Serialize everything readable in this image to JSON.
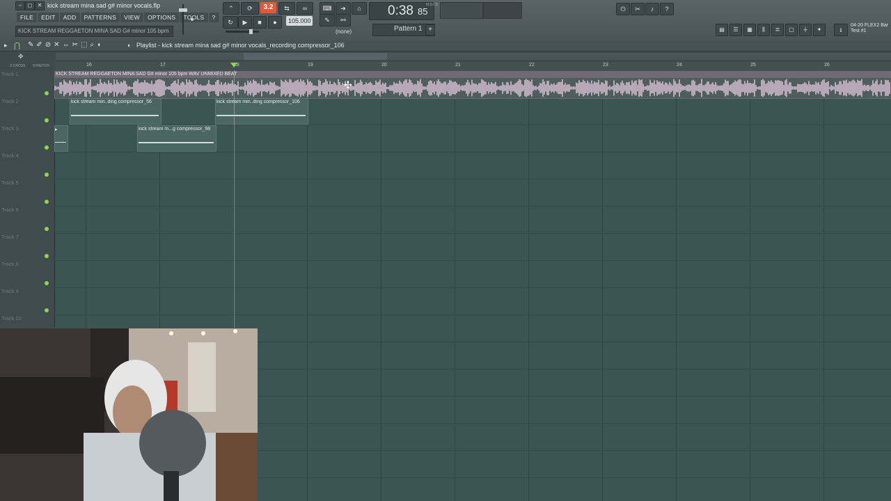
{
  "window": {
    "title": "kick stream mina sad g# minor vocals.flp",
    "menu": [
      "FILE",
      "EDIT",
      "ADD",
      "PATTERNS",
      "VIEW",
      "OPTIONS",
      "TOOLS",
      "?"
    ],
    "hint": "KICK STREAM REGGAETON MINA SAD G# minor 105 bpm"
  },
  "transport": {
    "rec_indicator": "3.2",
    "tempo": "105.000",
    "time_main": "0:38",
    "time_frac": "85",
    "time_unit": "M:S:CS",
    "pattern": "Pattern 1",
    "none": "(none)"
  },
  "right_panel": {
    "line1": "04-20 FLEX2 Bar",
    "line2": "Test #1"
  },
  "playlist": {
    "title": "Playlist - kick stream mina sad g# minor vocals_recording compressor_106",
    "bars": [
      "16",
      "17",
      "18",
      "19",
      "20",
      "21",
      "22",
      "23",
      "24",
      "25",
      "26"
    ],
    "tracks": [
      "Track 1",
      "Track 2",
      "Track 3",
      "Track 4",
      "Track 5",
      "Track 6",
      "Track 7",
      "Track 8",
      "Track 9",
      "Track 10"
    ],
    "header_labels": [
      "Z-CROSS",
      "STRETCH"
    ],
    "clips": {
      "main": "KICK STREAM REGGAETON MINA SAD G# minor 105 bpm WAV UNMIXED BEAT",
      "t2a": "kick stream min..ding compressor_56",
      "t2b": "kick stream min..ding compressor_106",
      "t3": "kick stream m...g compressor_98"
    }
  },
  "colors": {
    "grid": "#3a5552",
    "accent_green": "#8fd64a",
    "record_orange": "#e05a33",
    "main_clip_header": "#6e6b74"
  }
}
